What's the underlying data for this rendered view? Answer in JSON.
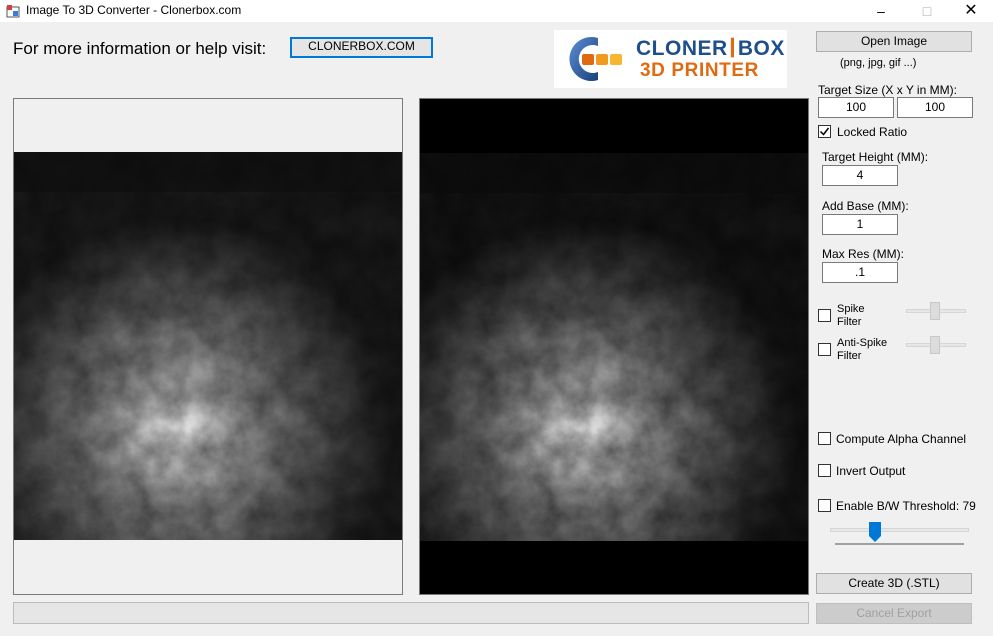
{
  "window": {
    "title": "Image To 3D Converter - Clonerbox.com"
  },
  "header": {
    "info_text": "For more information or help visit:",
    "link_label": "CLONERBOX.COM"
  },
  "logo": {
    "line1_a": "CLONER",
    "line1_b": "BOX",
    "line2": "3D PRINTER",
    "colors": {
      "blue": "#1f4f8b",
      "orange": "#e06a12"
    }
  },
  "controls": {
    "open_image_label": "Open Image",
    "formats_hint": "(png, jpg, gif ...)",
    "target_size_label": "Target Size (X x Y in MM):",
    "size_x": "100",
    "size_y": "100",
    "locked_ratio_label": "Locked Ratio",
    "locked_ratio_checked": true,
    "target_height_label": "Target Height (MM):",
    "target_height": "4",
    "add_base_label": "Add Base (MM):",
    "add_base": "1",
    "max_res_label": "Max Res (MM):",
    "max_res": ".1",
    "spike_filter_label_1": "Spike",
    "spike_filter_label_2": "Filter",
    "anti_spike_label_1": "Anti-Spike",
    "anti_spike_label_2": "Filter",
    "compute_alpha_label": "Compute Alpha Channel",
    "invert_output_label": "Invert Output",
    "bw_threshold_label": "Enable B/W Threshold: 79",
    "bw_threshold_value": 79,
    "create_label": "Create 3D (.STL)",
    "cancel_label": "Cancel Export"
  },
  "theme": {
    "accent": "#0078d7"
  }
}
